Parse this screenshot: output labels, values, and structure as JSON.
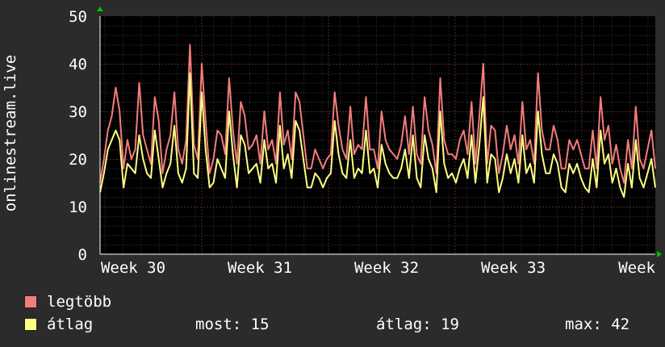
{
  "chart_data": {
    "type": "line",
    "ylabel": "onlinestream.live",
    "ylim": [
      0,
      50
    ],
    "yticks": [
      0,
      10,
      20,
      30,
      40,
      50
    ],
    "xticks": [
      "Week 30",
      "Week 31",
      "Week 32",
      "Week 33",
      "Week"
    ],
    "grid": true,
    "series": [
      {
        "name": "legtöbb",
        "color": "#f47c7c",
        "values": [
          15,
          20,
          26,
          29,
          35,
          30,
          18,
          24,
          20,
          22,
          36,
          25,
          22,
          19,
          33,
          28,
          17,
          22,
          25,
          34,
          22,
          19,
          24,
          44,
          23,
          20,
          40,
          28,
          17,
          20,
          26,
          25,
          21,
          37,
          26,
          19,
          32,
          29,
          22,
          23,
          25,
          19,
          30,
          22,
          24,
          19,
          34,
          23,
          26,
          20,
          34,
          32,
          25,
          18,
          18,
          22,
          20,
          18,
          20,
          21,
          34,
          27,
          22,
          20,
          31,
          21,
          23,
          22,
          33,
          22,
          22,
          18,
          30,
          24,
          22,
          21,
          20,
          23,
          29,
          21,
          31,
          21,
          19,
          33,
          26,
          23,
          17,
          37,
          24,
          21,
          21,
          20,
          24,
          26,
          21,
          32,
          19,
          29,
          40,
          19,
          27,
          26,
          17,
          21,
          27,
          22,
          25,
          19,
          32,
          22,
          24,
          19,
          38,
          26,
          22,
          22,
          27,
          24,
          18,
          18,
          24,
          22,
          24,
          21,
          18,
          18,
          26,
          18,
          33,
          24,
          27,
          19,
          23,
          18,
          15,
          24,
          18,
          31,
          20,
          18,
          22,
          26,
          18
        ]
      },
      {
        "name": "átlag",
        "color": "#ffff80",
        "values": [
          13,
          17,
          22,
          24,
          26,
          24,
          14,
          19,
          18,
          17,
          25,
          20,
          17,
          16,
          26,
          20,
          14,
          17,
          19,
          27,
          17,
          15,
          18,
          38,
          17,
          16,
          34,
          22,
          14,
          15,
          20,
          18,
          16,
          30,
          21,
          14,
          25,
          23,
          17,
          18,
          19,
          15,
          24,
          18,
          19,
          15,
          27,
          18,
          21,
          16,
          28,
          26,
          20,
          14,
          14,
          17,
          16,
          14,
          16,
          17,
          28,
          21,
          17,
          16,
          24,
          16,
          18,
          17,
          26,
          17,
          18,
          14,
          23,
          19,
          17,
          16,
          16,
          18,
          22,
          16,
          25,
          16,
          14,
          25,
          20,
          18,
          13,
          30,
          19,
          16,
          17,
          15,
          18,
          20,
          16,
          25,
          15,
          23,
          33,
          15,
          21,
          20,
          13,
          16,
          21,
          17,
          20,
          15,
          25,
          17,
          19,
          15,
          30,
          21,
          17,
          17,
          21,
          19,
          14,
          13,
          19,
          17,
          19,
          16,
          14,
          13,
          20,
          14,
          26,
          19,
          21,
          15,
          18,
          14,
          12,
          19,
          14,
          24,
          16,
          14,
          17,
          20,
          14
        ]
      }
    ]
  },
  "legend": [
    {
      "label": "legtöbb",
      "color": "#f47c7c"
    },
    {
      "label": "átlag",
      "color": "#ffff80"
    }
  ],
  "stats": {
    "most": "most: 15",
    "atlag": "átlag: 19",
    "max": "max: 42"
  }
}
